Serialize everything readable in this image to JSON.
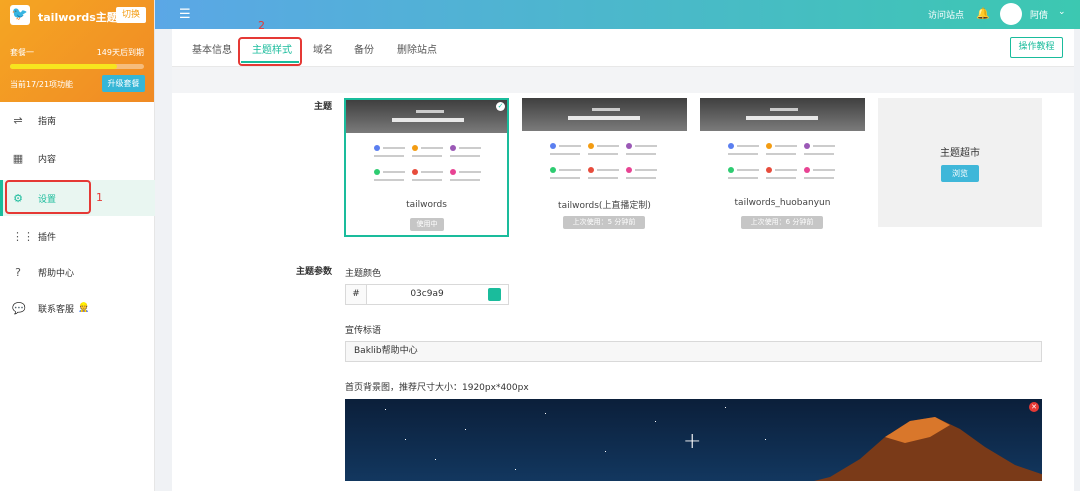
{
  "sidebar": {
    "site_name": "tailwords主题...",
    "switch_label": "切换",
    "plan_name": "套餐一",
    "expire": "149天后到期",
    "usage_fraction": 0.8,
    "features": "当前17/21项功能",
    "upgrade_label": "升级套餐",
    "items": [
      {
        "label": "指南",
        "icon": "signpost-icon"
      },
      {
        "label": "内容",
        "icon": "grid-icon"
      },
      {
        "label": "设置",
        "icon": "gear-icon"
      },
      {
        "label": "插件",
        "icon": "apps-icon"
      },
      {
        "label": "帮助中心",
        "icon": "help-icon"
      },
      {
        "label": "联系客服",
        "icon": "chat-icon"
      }
    ],
    "annotation": "1"
  },
  "topbar": {
    "visit_label": "访问站点",
    "user_name": "阿倩"
  },
  "tabs": {
    "items": [
      "基本信息",
      "主题样式",
      "域名",
      "备份",
      "删除站点"
    ],
    "active_index": 1,
    "annotation": "2"
  },
  "guide_button": "操作教程",
  "theme": {
    "label": "主题",
    "cards": [
      {
        "name": "tailwords",
        "badge": "使用中",
        "selected": true
      },
      {
        "name": "tailwords(上直播定制)",
        "badge": "上次使用：5 分钟前",
        "selected": false
      },
      {
        "name": "tailwords_huobanyun",
        "badge": "上次使用：6 分钟前",
        "selected": false
      }
    ],
    "market_title": "主题超市",
    "market_button": "浏览"
  },
  "params": {
    "label": "主题参数",
    "color_label": "主题颜色",
    "hash": "#",
    "color_value": "03c9a9",
    "color_swatch": "#1abc9c",
    "slogan_label": "宣传标语",
    "slogan_value": "Baklib帮助中心",
    "bg_label": "首页背景图，推荐尺寸大小：1920px*400px"
  },
  "colors": {
    "accent": "#1abc9c",
    "annotation_red": "#e53935"
  }
}
